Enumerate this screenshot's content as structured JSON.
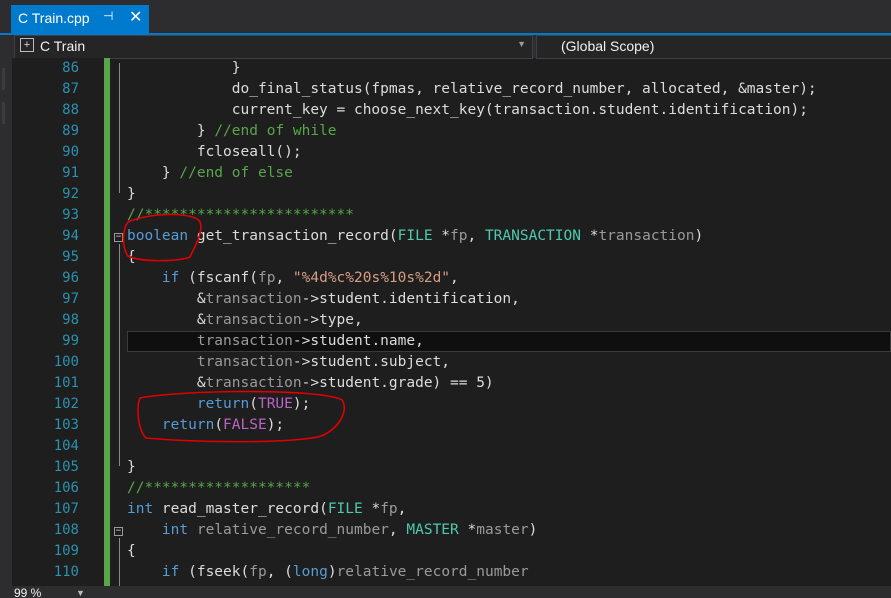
{
  "tab": {
    "title": "C Train.cpp",
    "pin": "⊣",
    "close": "✕"
  },
  "navbar": {
    "project": "C Train",
    "scope": "(Global Scope)"
  },
  "status": {
    "zoom": "99 %"
  },
  "lines": [
    {
      "n": "86",
      "c": [
        [
          "p",
          "            }"
        ]
      ]
    },
    {
      "n": "87",
      "c": [
        [
          "p",
          "            do_final_status(fpmas, relative_record_number, allocated, &master);"
        ]
      ]
    },
    {
      "n": "88",
      "c": [
        [
          "p",
          "            current_key = choose_next_key(transaction.student.identification);"
        ]
      ]
    },
    {
      "n": "89",
      "c": [
        [
          "p",
          "        } "
        ],
        [
          "cm",
          "//end of while"
        ]
      ]
    },
    {
      "n": "90",
      "c": [
        [
          "p",
          "        fcloseall();"
        ]
      ]
    },
    {
      "n": "91",
      "c": [
        [
          "p",
          "    } "
        ],
        [
          "cm",
          "//end of else"
        ]
      ]
    },
    {
      "n": "92",
      "c": [
        [
          "p",
          "}"
        ]
      ]
    },
    {
      "n": "93",
      "c": [
        [
          "cm",
          "//************************"
        ]
      ]
    },
    {
      "n": "94",
      "c": [
        [
          "kw",
          "boolean"
        ],
        [
          "p",
          " get_transaction_record("
        ],
        [
          "ty",
          "FILE"
        ],
        [
          "p",
          " *"
        ],
        [
          "par",
          "fp"
        ],
        [
          "p",
          ", "
        ],
        [
          "ty",
          "TRANSACTION"
        ],
        [
          "p",
          " *"
        ],
        [
          "par",
          "transaction"
        ],
        [
          "p",
          ")"
        ]
      ]
    },
    {
      "n": "95",
      "c": [
        [
          "p",
          "{"
        ]
      ]
    },
    {
      "n": "96",
      "c": [
        [
          "p",
          "    "
        ],
        [
          "kw",
          "if"
        ],
        [
          "p",
          " (fscanf("
        ],
        [
          "par",
          "fp"
        ],
        [
          "p",
          ", "
        ],
        [
          "str",
          "\"%4d%c%20s%10s%2d\""
        ],
        [
          "p",
          ","
        ]
      ]
    },
    {
      "n": "97",
      "c": [
        [
          "p",
          "        &"
        ],
        [
          "par",
          "transaction"
        ],
        [
          "p",
          "->student.identification,"
        ]
      ]
    },
    {
      "n": "98",
      "c": [
        [
          "p",
          "        &"
        ],
        [
          "par",
          "transaction"
        ],
        [
          "p",
          "->type,"
        ]
      ]
    },
    {
      "n": "99",
      "c": [
        [
          "p",
          "        "
        ],
        [
          "par",
          "transaction"
        ],
        [
          "p",
          "->student.name,"
        ]
      ]
    },
    {
      "n": "100",
      "c": [
        [
          "p",
          "        "
        ],
        [
          "par",
          "transaction"
        ],
        [
          "p",
          "->student.subject,"
        ]
      ]
    },
    {
      "n": "101",
      "c": [
        [
          "p",
          "        &"
        ],
        [
          "par",
          "transaction"
        ],
        [
          "p",
          "->student.grade) == 5)"
        ]
      ]
    },
    {
      "n": "102",
      "c": [
        [
          "p",
          "        "
        ],
        [
          "kw",
          "return"
        ],
        [
          "p",
          "("
        ],
        [
          "mac",
          "TRUE"
        ],
        [
          "p",
          ");"
        ]
      ]
    },
    {
      "n": "103",
      "c": [
        [
          "p",
          "    "
        ],
        [
          "kw",
          "return"
        ],
        [
          "p",
          "("
        ],
        [
          "mac",
          "FALSE"
        ],
        [
          "p",
          ");"
        ]
      ]
    },
    {
      "n": "104",
      "c": [
        [
          "p",
          ""
        ]
      ]
    },
    {
      "n": "105",
      "c": [
        [
          "p",
          "}"
        ]
      ]
    },
    {
      "n": "106",
      "c": [
        [
          "cm",
          "//*******************"
        ]
      ]
    },
    {
      "n": "107",
      "c": [
        [
          "kw",
          "int"
        ],
        [
          "p",
          " read_master_record("
        ],
        [
          "ty",
          "FILE"
        ],
        [
          "p",
          " *"
        ],
        [
          "par",
          "fp"
        ],
        [
          "p",
          ","
        ]
      ]
    },
    {
      "n": "108",
      "c": [
        [
          "p",
          "    "
        ],
        [
          "kw",
          "int"
        ],
        [
          "p",
          " "
        ],
        [
          "par",
          "relative_record_number"
        ],
        [
          "p",
          ", "
        ],
        [
          "ty",
          "MASTER"
        ],
        [
          "p",
          " *"
        ],
        [
          "par",
          "master"
        ],
        [
          "p",
          ")"
        ]
      ]
    },
    {
      "n": "109",
      "c": [
        [
          "p",
          "{"
        ]
      ]
    },
    {
      "n": "110",
      "c": [
        [
          "p",
          "    "
        ],
        [
          "kw",
          "if"
        ],
        [
          "p",
          " (fseek("
        ],
        [
          "par",
          "fp"
        ],
        [
          "p",
          ", ("
        ],
        [
          "kw",
          "long"
        ],
        [
          "p",
          ")"
        ],
        [
          "par",
          "relative_record_number"
        ]
      ]
    }
  ]
}
